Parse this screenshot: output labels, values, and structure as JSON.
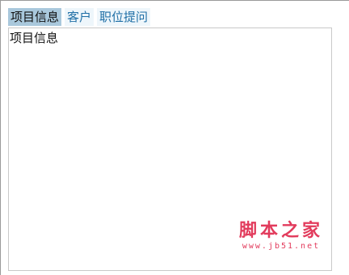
{
  "tabs": [
    {
      "label": "项目信息",
      "active": true
    },
    {
      "label": "客户",
      "active": false
    },
    {
      "label": "职位提问",
      "active": false
    }
  ],
  "panel": {
    "content": "项目信息"
  },
  "watermark": {
    "text": "脚本之家",
    "url": "www.jb51.net"
  },
  "colors": {
    "active_tab": "#a9c8dc",
    "tab_bg": "#eef6fb",
    "tab_text": "#1f6fa6",
    "watermark": "#e23b5c"
  }
}
